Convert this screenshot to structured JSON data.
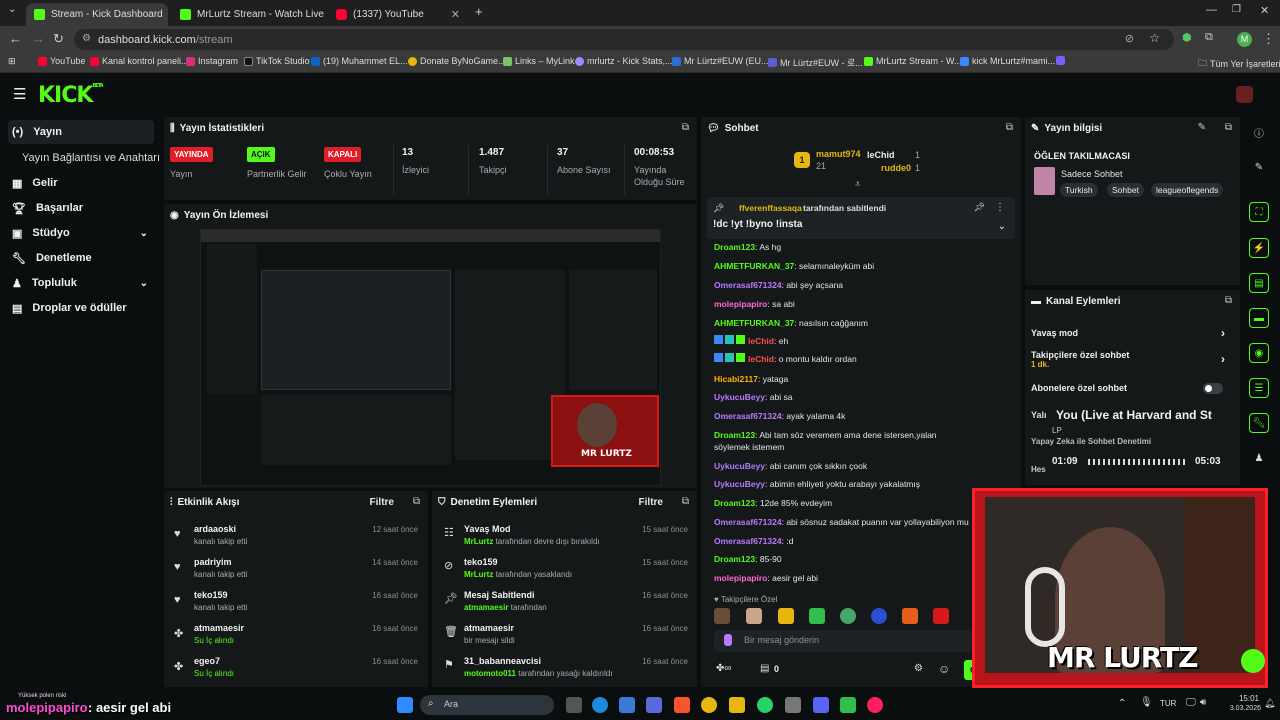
{
  "browser": {
    "tabs": [
      {
        "title": "Stream - Kick Dashboard",
        "active": true
      },
      {
        "title": "MrLurtz Stream - Watch Live on",
        "active": false
      },
      {
        "title": "(1337) YouTube",
        "active": false
      }
    ],
    "url_host": "dashboard.kick.com",
    "url_path": "/stream",
    "bookmarks": [
      "YouTube",
      "Kanal kontrol paneli...",
      "Instagram",
      "TikTok Studio",
      "(19) Muhammet EL...",
      "Donate ByNoGame...",
      "Links – MyLink",
      "mrlurtz - Kick Stats,...",
      "Mr Lürtz#EUW (EU...",
      "Mr Lürtz#EUW - 로...",
      "MrLurtz Stream - W...",
      "kick MrLurtz#mami...",
      "Tüm Yer İşaretleri"
    ],
    "profile_initial": "M"
  },
  "kick": {
    "logo": "KICK",
    "logo_sup": "BETA"
  },
  "sidebar": {
    "items": [
      {
        "label": "Yayın",
        "active": true
      },
      {
        "label": "Yayın Bağlantısı ve Anahtarı"
      },
      {
        "label": "Gelir"
      },
      {
        "label": "Başarılar"
      },
      {
        "label": "Stüdyo"
      },
      {
        "label": "Denetleme"
      },
      {
        "label": "Topluluk"
      },
      {
        "label": "Droplar ve ödüller"
      }
    ]
  },
  "stats": {
    "title": "Yayın İstatistikleri",
    "items": [
      {
        "badge": "YAYINDA",
        "label": "Yayın"
      },
      {
        "badge": "AÇIK",
        "label": "Partnerlik Gelir"
      },
      {
        "badge": "KAPALI",
        "label": "Çoklu Yayın"
      },
      {
        "value": "13",
        "label": "İzleyici"
      },
      {
        "value": "1.487",
        "label": "Takipçi"
      },
      {
        "value": "37",
        "label": "Abone Sayısı"
      },
      {
        "value": "00:08:53",
        "label": "Yayında Olduğu Süre"
      }
    ]
  },
  "preview": {
    "title": "Yayın Ön İzlemesi",
    "overlay_name": "MR LURTZ"
  },
  "activity": {
    "title": "Etkinlik Akışı",
    "filter": "Filtre",
    "events": [
      {
        "name": "ardaaoski",
        "desc": "kanalı takip etti",
        "time": "12 saat önce",
        "icon": "heart-icon"
      },
      {
        "name": "padriyim",
        "desc": "kanalı takip etti",
        "time": "14 saat önce",
        "icon": "heart-icon"
      },
      {
        "name": "teko159",
        "desc": "kanalı takip etti",
        "time": "16 saat önce",
        "icon": "heart-icon"
      },
      {
        "name": "atmamaesir",
        "desc": "Su İç alındı",
        "time": "16 saat önce",
        "icon": "reward-icon"
      },
      {
        "name": "egeo7",
        "desc": "Su İç alındı",
        "time": "16 saat önce",
        "icon": "reward-icon"
      }
    ]
  },
  "moderation": {
    "title": "Denetim Eylemleri",
    "filter": "Filtre",
    "events": [
      {
        "name": "Yavaş Mod",
        "by": "MrLurtz",
        "rest": "tarafından devre dışı bırakıldı",
        "time": "15 saat önce"
      },
      {
        "name": "teko159",
        "by": "MrLurtz",
        "rest": "tarafından yasaklandı",
        "time": "15 saat önce"
      },
      {
        "name": "Mesaj Sabitlendi",
        "by": "atmamaesir",
        "rest": "tarafından",
        "time": "16 saat önce"
      },
      {
        "name": "atmamaesir",
        "by": "",
        "rest": "bir mesajı sildi",
        "time": "16 saat önce"
      },
      {
        "name": "31_babanneavcisi",
        "by": "motomoto011",
        "rest": "tarafından yasağı kaldırıldı",
        "time": "16 saat önce"
      }
    ]
  },
  "chat": {
    "title": "Sohbet",
    "leaderboard": [
      {
        "name": "mamut974",
        "count": "21"
      },
      {
        "name": "leChid",
        "count": "1"
      },
      {
        "name": "rudde0",
        "count": "1"
      }
    ],
    "pinned_by": "ffverenffassaqa",
    "pinned_suffix": "tarafından sabitlendi",
    "pinned_text": "!dc !yt !byno !insta",
    "messages": [
      {
        "user": "Droam123",
        "text": "As hg",
        "color": "#53fc18"
      },
      {
        "user": "AHMETFURKAN_37",
        "text": "selamınaleyküm abi",
        "color": "#53fc18"
      },
      {
        "user": "Omerasaf671324",
        "text": "abi şey açsana",
        "color": "#b77bff"
      },
      {
        "user": "molepipapiro",
        "text": "sa abi",
        "color": "#ff6ad5"
      },
      {
        "user": "AHMETFURKAN_37",
        "text": "nasılsın cağğanım",
        "color": "#53fc18"
      },
      {
        "user": "leChid",
        "text": "eh",
        "color": "#ff4d4d"
      },
      {
        "user": "leChid",
        "text": "o montu kaldır ordan",
        "color": "#ff4d4d"
      },
      {
        "user": "Hicabi2117",
        "text": "yataga",
        "color": "#ffb000"
      },
      {
        "user": "UykucuBeyy",
        "text": "abi sa",
        "color": "#b77bff"
      },
      {
        "user": "Omerasaf671324",
        "text": "ayak yalama 4k",
        "color": "#b77bff"
      },
      {
        "user": "Droam123",
        "text": "Abi tam söz veremem ama dene istersen,yalan söylemek istemem",
        "color": "#53fc18"
      },
      {
        "user": "UykucuBeyy",
        "text": "abi canım çok sıkkın çook",
        "color": "#b77bff"
      },
      {
        "user": "UykucuBeyy",
        "text": "abimin ehliyeti yoktu arabayı yakalatmış",
        "color": "#b77bff"
      },
      {
        "user": "Droam123",
        "text": "12de 85% evdeyim",
        "color": "#53fc18"
      },
      {
        "user": "Omerasaf671324",
        "text": "abi sösnuz sadakat puanın var yollayabiliyon mu",
        "color": "#b77bff"
      },
      {
        "user": "Omerasaf671324",
        "text": ":d",
        "color": "#b77bff"
      },
      {
        "user": "Droam123",
        "text": "85-90",
        "color": "#53fc18"
      },
      {
        "user": "molepipapiro",
        "text": "aesir gel abi",
        "color": "#ff6ad5"
      }
    ],
    "followers_only_label": "Takipçilere Özel",
    "input_placeholder": "Bir mesaj gönderin",
    "points": "0",
    "send": "Gönder"
  },
  "stream_info": {
    "title": "Yayın bilgisi",
    "stream_title": "ÖĞLEN TAKILMACASI",
    "category": "Sadece Sohbet",
    "tags": [
      "Turkish",
      "Sohbet",
      "leagueoflegends"
    ]
  },
  "channel_actions": {
    "title": "Kanal Eylemleri",
    "items": [
      {
        "label": "Yavaş mod"
      },
      {
        "label": "Takipçilere özel sohbet",
        "sub": "1 dk."
      },
      {
        "label": "Abonelere özel sohbet"
      }
    ]
  },
  "overlay": {
    "song": "You (Live at Harvard and St",
    "song_sub": "LP",
    "time_elapsed": "01:09",
    "time_total": "05:03",
    "partial_a": "Yalı",
    "partial_b": "Yapay Zeka ile Sohbet Denetimi",
    "partial_c": "Hes",
    "cam_name": "MR LURTZ",
    "banner_user": "molepipapiro",
    "banner_text": ": aesir gel abi",
    "banner_small": "Yüksek polen riski"
  },
  "taskbar": {
    "search": "Ara",
    "lang": "TUR",
    "time": "15:01",
    "date": "3.03.2026"
  },
  "colors": {
    "accent": "#53fc18",
    "live": "#e11d2a",
    "panel": "#141819"
  }
}
